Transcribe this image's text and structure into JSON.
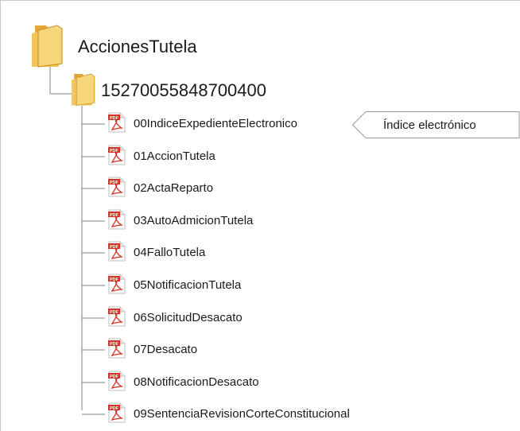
{
  "tree": {
    "root": {
      "label": "AccionesTutela",
      "icon": "folder-icon"
    },
    "subfolder": {
      "label": "15270055848700400",
      "icon": "folder-icon"
    },
    "files": [
      {
        "label": "00IndiceExpedienteElectronico",
        "icon": "pdf-icon"
      },
      {
        "label": "01AccionTutela",
        "icon": "pdf-icon"
      },
      {
        "label": "02ActaReparto",
        "icon": "pdf-icon"
      },
      {
        "label": "03AutoAdmicionTutela",
        "icon": "pdf-icon"
      },
      {
        "label": "04FalloTutela",
        "icon": "pdf-icon"
      },
      {
        "label": "05NotificacionTutela",
        "icon": "pdf-icon"
      },
      {
        "label": "06SolicitudDesacato",
        "icon": "pdf-icon"
      },
      {
        "label": "07Desacato",
        "icon": "pdf-icon"
      },
      {
        "label": "08NotificacionDesacato",
        "icon": "pdf-icon"
      },
      {
        "label": "09SentenciaRevisionCorteConstitucional",
        "icon": "pdf-icon"
      }
    ]
  },
  "callout": {
    "text": "Índice electrónico",
    "points_to": "00IndiceExpedienteElectronico"
  },
  "pdf_badge": "PDF",
  "colors": {
    "folder_front": "#f7cf6a",
    "folder_back": "#e2a93a",
    "pdf_red": "#d93025",
    "line": "#7f7f7f"
  }
}
